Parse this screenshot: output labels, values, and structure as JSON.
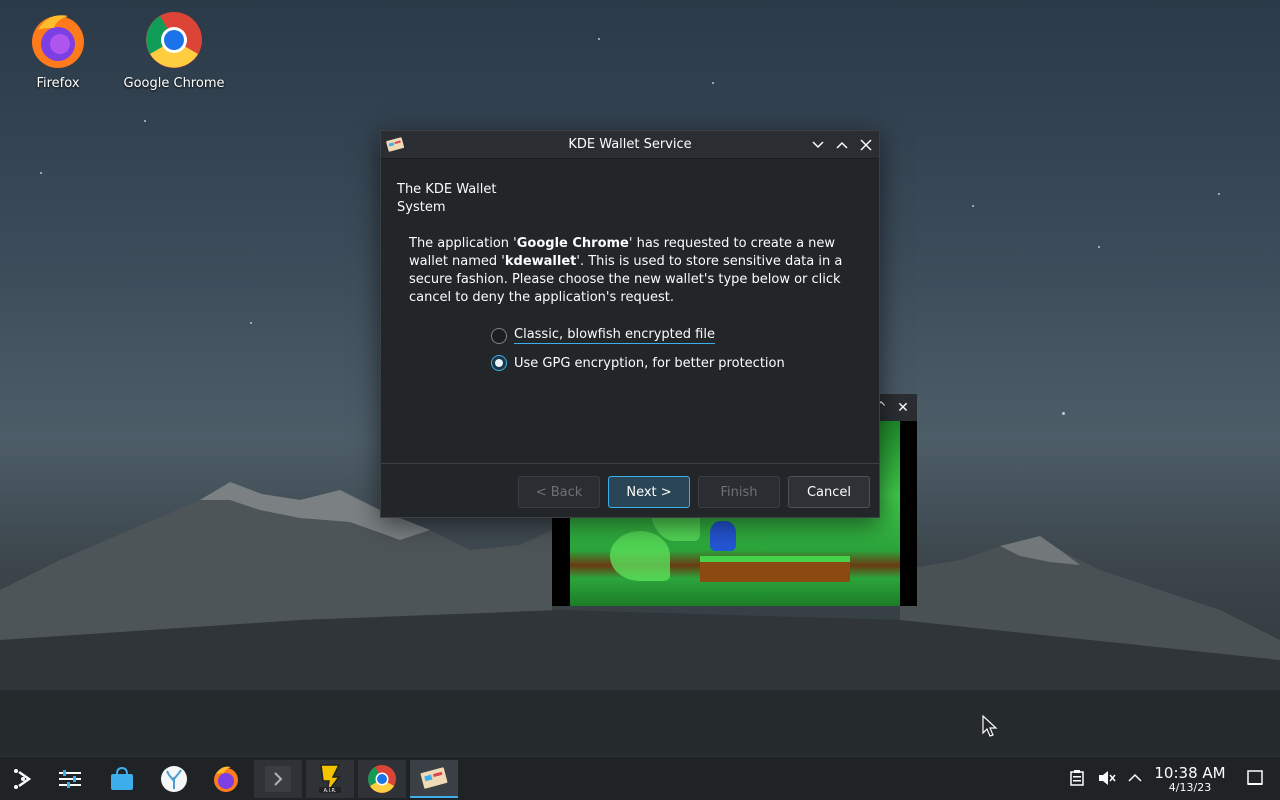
{
  "desktop": {
    "icons": [
      {
        "label": "Firefox",
        "icon": "firefox-icon"
      },
      {
        "label": "Google Chrome",
        "icon": "chrome-icon"
      }
    ]
  },
  "dialog": {
    "title": "KDE Wallet Service",
    "heading_line1": "The KDE Wallet",
    "heading_line2": "System",
    "message": {
      "part1": "The application '",
      "app": "Google Chrome",
      "part2": "' has requested to create a new wallet named '",
      "wallet": "kdewallet",
      "part3": "'. This is used to store sensitive data in a secure fashion. Please choose the new wallet's type below or click cancel to deny the application's request."
    },
    "options": [
      {
        "label": "Classic, blowfish encrypted file",
        "selected": false
      },
      {
        "label": "Use GPG encryption, for better protection",
        "selected": true
      }
    ],
    "buttons": {
      "back": "< Back",
      "next": "Next >",
      "finish": "Finish",
      "cancel": "Cancel"
    }
  },
  "taskbar": {
    "items": [
      "application-launcher-icon",
      "system-settings-icon",
      "discover-store-icon",
      "coral-app-icon",
      "firefox-icon",
      "terminal-icon",
      "sonic-3-air-icon",
      "chrome-icon",
      "kde-wallet-icon"
    ],
    "tray": [
      "clipboard-icon",
      "volume-muted-icon",
      "tray-expand-icon"
    ],
    "clock_time": "10:38 AM",
    "clock_date": "4/13/23"
  },
  "colors": {
    "accent": "#3daee9",
    "window_bg": "#232629",
    "taskbar_bg": "#202326"
  }
}
